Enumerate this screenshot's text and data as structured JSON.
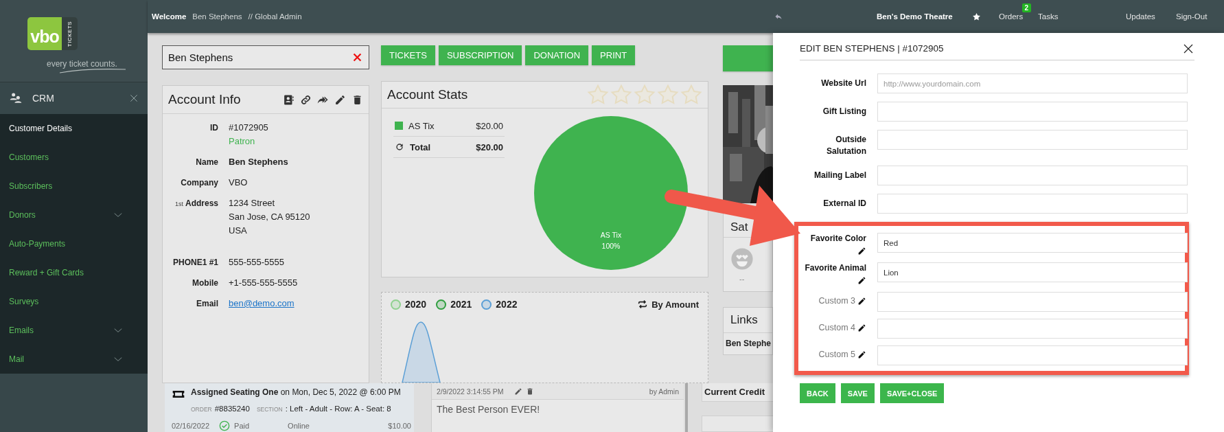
{
  "logo": {
    "wordmark": "vbo",
    "side": "TICKETS",
    "tagline": "every ticket counts."
  },
  "topbar": {
    "welcome": "Welcome",
    "user": "Ben Stephens",
    "role": "// Global Admin",
    "theatre": "Ben's Demo Theatre",
    "nav": [
      {
        "label": "Orders",
        "badge": "2"
      },
      {
        "label": "Tasks"
      }
    ],
    "account_links": [
      "Updates",
      "Sign-Out"
    ]
  },
  "sidebar": {
    "section": "CRM",
    "items": [
      {
        "label": "Customer Details",
        "selected": true,
        "expandable": false
      },
      {
        "label": "Customers",
        "selected": false,
        "expandable": false
      },
      {
        "label": "Subscribers",
        "selected": false,
        "expandable": false
      },
      {
        "label": "Donors",
        "selected": false,
        "expandable": true
      },
      {
        "label": "Auto-Payments",
        "selected": false,
        "expandable": false
      },
      {
        "label": "Reward + Gift Cards",
        "selected": false,
        "expandable": false
      },
      {
        "label": "Surveys",
        "selected": false,
        "expandable": false
      },
      {
        "label": "Emails",
        "selected": false,
        "expandable": true
      },
      {
        "label": "Mail",
        "selected": false,
        "expandable": true
      }
    ]
  },
  "search": {
    "value": "Ben Stephens"
  },
  "actions": [
    "TICKETS",
    "SUBSCRIPTION",
    "DONATION",
    "PRINT"
  ],
  "account_info": {
    "title": "Account Info",
    "rows": [
      {
        "label": "ID",
        "lines": [
          "#1072905"
        ],
        "note": "Patron",
        "kind": "plain"
      },
      {
        "label": "Name",
        "lines": [
          "Ben Stephens"
        ],
        "kind": "bold"
      },
      {
        "label": "Company",
        "lines": [
          "VBO"
        ],
        "kind": "plain"
      },
      {
        "label_prefix": "1st",
        "label": "Address",
        "lines": [
          "1234 Street",
          "San Jose, CA 95120",
          "USA"
        ],
        "kind": "plain"
      }
    ],
    "contact_rows": [
      {
        "label": "PHONE1 #1",
        "lines": [
          "555-555-5555"
        ],
        "kind": "plain"
      },
      {
        "label": "Mobile",
        "lines": [
          "+1-555-555-5555"
        ],
        "kind": "plain"
      },
      {
        "label": "Email",
        "lines": [
          "ben@demo.com"
        ],
        "kind": "link"
      }
    ]
  },
  "account_stats": {
    "title": "Account Stats",
    "stars": 0,
    "rows": [
      {
        "kind": "item",
        "label": "AS Tix",
        "amount": "$20.00",
        "color": "#3fb34f"
      },
      {
        "kind": "total",
        "label": "Total",
        "amount": "$20.00"
      }
    ],
    "chart_data": {
      "type": "pie",
      "series": [
        {
          "name": "AS Tix",
          "color": "#3fb34f",
          "values": [
            100
          ]
        }
      ],
      "value_labels": [
        "100%"
      ]
    }
  },
  "sales_chart": {
    "legend": [
      {
        "label": "2020",
        "color": "#8fd18f"
      },
      {
        "label": "2021",
        "color": "#2f9e3f"
      },
      {
        "label": "2022",
        "color": "#5b9fd6"
      }
    ],
    "toggle": "By Amount"
  },
  "side_panels": {
    "satisfaction_title": "Sat",
    "satisfaction_score": "--",
    "links_title": "Links",
    "link": "Ben Stephe",
    "credit": "Current Credit"
  },
  "order": {
    "event": "**Assigned Seating One** on Mon, Dec 5, 2022 @ 6:00 PM",
    "order_label": "ORDER",
    "order_no": "#8835240",
    "section_label": "SECTION",
    "section": ": Left - Adult - Row: A - Seat: 8",
    "date": "02/16/2022",
    "status": "Paid",
    "channel": "Online",
    "amount": "$10.00"
  },
  "note": {
    "timestamp": "2/9/2022 3:14:55 PM",
    "author": "by Admin",
    "text": "The Best Person EVER!"
  },
  "drawer": {
    "title": "EDIT BEN STEPHENS | #1072905",
    "fields": [
      {
        "label": "Website Url",
        "kind": "standard",
        "placeholder": "http://www.yourdomain.com",
        "highlighted": false
      },
      {
        "label": "Gift Listing",
        "kind": "standard",
        "highlighted": false
      },
      {
        "label": "Outside Salutation",
        "kind": "standard",
        "highlighted": false
      },
      {
        "label": "Mailing Label",
        "kind": "standard",
        "highlighted": false
      },
      {
        "label": "External ID",
        "kind": "standard",
        "highlighted": false
      },
      {
        "label": "Favorite Color",
        "kind": "custom_named",
        "value": "Red",
        "highlighted": true
      },
      {
        "label": "Favorite Animal",
        "kind": "custom_named",
        "value": "Lion",
        "highlighted": true
      },
      {
        "label": "Custom 3",
        "kind": "custom_unnamed",
        "highlighted": true
      },
      {
        "label": "Custom 4",
        "kind": "custom_unnamed",
        "highlighted": true
      },
      {
        "label": "Custom 5",
        "kind": "custom_unnamed",
        "highlighted": true
      }
    ],
    "buttons": [
      "BACK",
      "SAVE",
      "SAVE+CLOSE"
    ]
  }
}
